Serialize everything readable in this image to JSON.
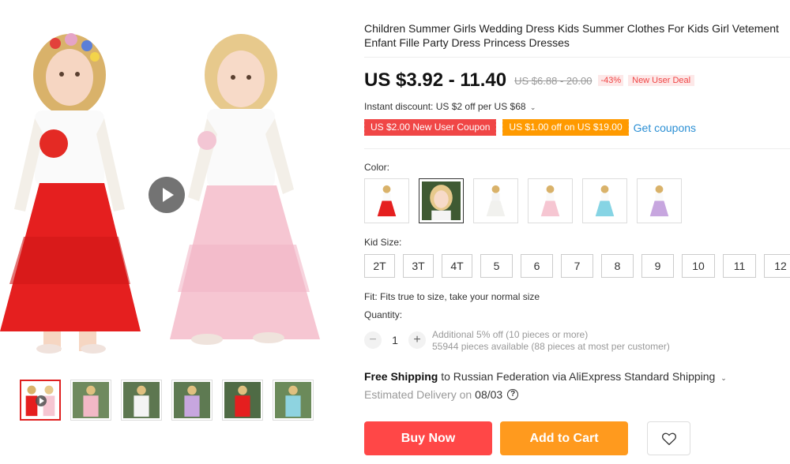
{
  "product": {
    "title": "Children Summer Girls Wedding Dress Kids Summer Clothes For Kids Girl Vetement Enfant Fille Party Dress Princess Dresses",
    "price": "US $3.92 - 11.40",
    "original_price": "US $6.88 - 20.00",
    "discount_pct": "-43%",
    "deal_badge": "New User Deal",
    "instant_discount": "Instant discount: US $2 off per US $68",
    "coupons": [
      "US $2.00 New User Coupon",
      "US $1.00 off on US $19.00"
    ],
    "get_coupons": "Get coupons"
  },
  "color": {
    "label": "Color:",
    "options": [
      "red-dress",
      "girl-photo",
      "white-dress",
      "pink-dress",
      "blue-dress",
      "purple-dress"
    ]
  },
  "size": {
    "label": "Kid Size:",
    "options": [
      "2T",
      "3T",
      "4T",
      "5",
      "6",
      "7",
      "8",
      "9",
      "10",
      "11",
      "12"
    ]
  },
  "fit": "Fit: Fits true to size, take your normal size",
  "quantity": {
    "label": "Quantity:",
    "value": "1",
    "note1": "Additional 5% off (10 pieces or more)",
    "note2": "55944 pieces available (88 pieces at most per customer)"
  },
  "shipping": {
    "free": "Free Shipping",
    "rest": " to Russian Federation via AliExpress Standard Shipping",
    "delivery_label": "Estimated Delivery on",
    "delivery_date": "08/03"
  },
  "actions": {
    "buy": "Buy Now",
    "cart": "Add to Cart"
  },
  "colors": {
    "red": "#ff4747",
    "orange": "#ff9a1e",
    "link": "#2b8fd4"
  }
}
